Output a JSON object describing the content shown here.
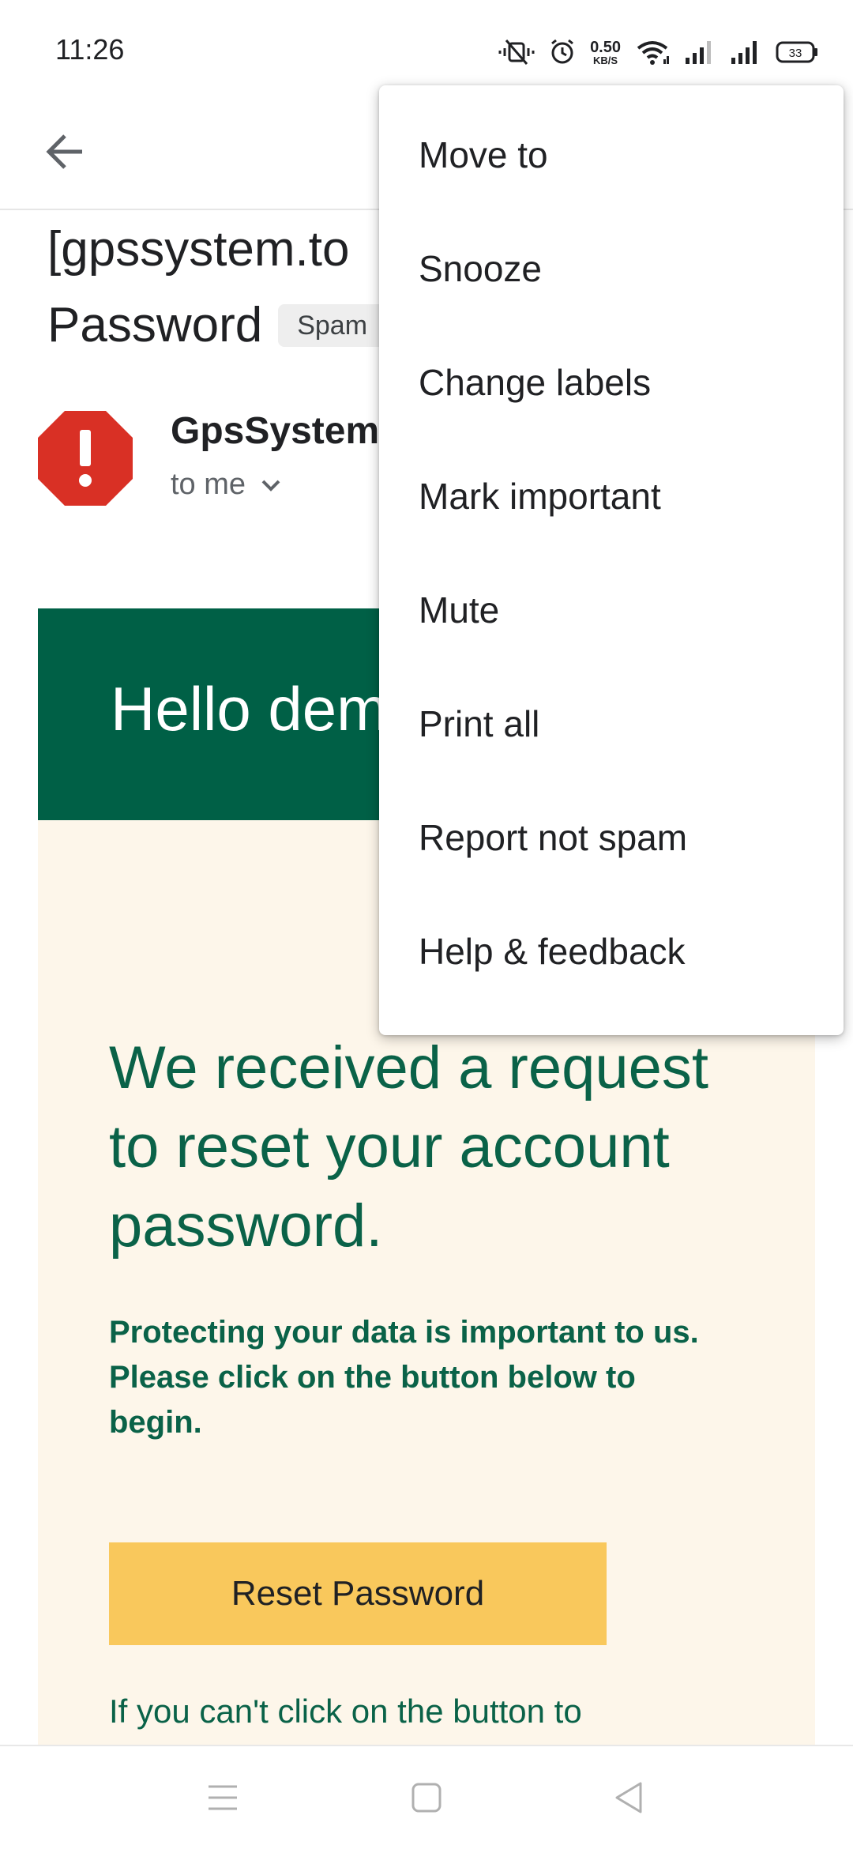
{
  "status_bar": {
    "time": "11:26",
    "net_speed_value": "0.50",
    "net_speed_unit": "KB/S",
    "battery_level": "33",
    "icons": [
      "vibrate-icon",
      "alarm-icon",
      "wifi-icon",
      "signal-icon",
      "signal-icon",
      "battery-icon"
    ]
  },
  "app_bar": {
    "back_icon": "arrow-left-icon"
  },
  "email": {
    "subject_line1": "[gpssystem.to",
    "subject_line2": "Password",
    "label_chip": "Spam",
    "sender_name": "GpsSystem",
    "recipient": "to me",
    "sender_avatar_icon": "warning-octagon-icon",
    "greeting": "Hello dem",
    "headline": "We received a request to reset your account password.",
    "note_line1": "Protecting your data is important to us.",
    "note_line2": "Please click on the button below to begin.",
    "button_label": "Reset Password",
    "fallback_text": "If you can't click on the button to"
  },
  "menu": {
    "items": [
      "Move to",
      "Snooze",
      "Change labels",
      "Mark important",
      "Mute",
      "Print all",
      "Report not spam",
      "Help & feedback"
    ]
  },
  "nav_bar": {
    "icons": [
      "menu-icon",
      "home-square-icon",
      "back-triangle-icon"
    ]
  },
  "colors": {
    "header_green": "#006046",
    "body_cream": "#fdf6ea",
    "text_green": "#0a6248",
    "button_yellow": "#f9c85c",
    "spam_red": "#d93025"
  }
}
